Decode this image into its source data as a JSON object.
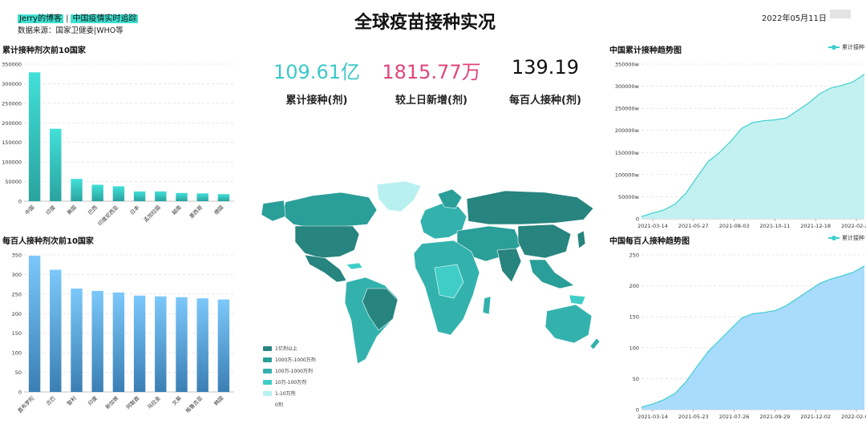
{
  "header": {
    "blog_link": "Jerry的博客",
    "separator": "|",
    "tracker_link": "中国疫情实时追踪",
    "source": "数据来源：国家卫健委|WHO等",
    "title": "全球疫苗接种实况",
    "date": "2022年05月11日"
  },
  "kpis": [
    {
      "value": "109.61亿",
      "label": "累计接种(剂)",
      "color": "#3cc8c8"
    },
    {
      "value": "1815.77万",
      "label": "较上日新增(剂)",
      "color": "#e0457b"
    },
    {
      "value": "139.19",
      "label": "每百人接种(剂)",
      "color": "#111111"
    }
  ],
  "map_legend": [
    {
      "label": "1亿剂以上",
      "color": "#27847f"
    },
    {
      "label": "1000万-1000万剂",
      "color": "#2a9e99"
    },
    {
      "label": "100万-1000万剂",
      "color": "#33b2ad"
    },
    {
      "label": "10万-100万剂",
      "color": "#40cdc7"
    },
    {
      "label": "1-10万剂",
      "color": "#b8f0f0"
    },
    {
      "label": "0剂",
      "color": "#ffffff"
    }
  ],
  "chart_data": [
    {
      "type": "bar",
      "title": "累计接种剂次前10国家",
      "categories": [
        "中国",
        "印度",
        "美国",
        "巴西",
        "印度尼西亚",
        "日本",
        "孟加拉国",
        "越南",
        "墨西哥",
        "德国"
      ],
      "values": [
        329000,
        185000,
        57000,
        42000,
        38000,
        25000,
        25000,
        21000,
        20000,
        18000
      ],
      "ylim": [
        0,
        350000
      ],
      "yticks": [
        "0",
        "50000",
        "100000",
        "150000",
        "200000",
        "250000",
        "300000",
        "350000"
      ],
      "grid": true,
      "color_top": "#41e0d8",
      "color_bottom": "#2aa39f"
    },
    {
      "type": "bar",
      "title": "每百人接种剂次前10国家",
      "categories": [
        "直布罗陀",
        "古巴",
        "智利",
        "印度",
        "新加坡",
        "阿联酋",
        "乌拉圭",
        "文莱",
        "格鲁吉亚",
        "韩国"
      ],
      "values": [
        348,
        312,
        264,
        258,
        254,
        246,
        244,
        242,
        239,
        236
      ],
      "ylim": [
        0,
        350
      ],
      "yticks": [
        "0",
        "50",
        "100",
        "150",
        "200",
        "250",
        "300",
        "350"
      ],
      "grid": true,
      "color_top": "#7cc8fa",
      "color_bottom": "#3a7fb4"
    },
    {
      "type": "area",
      "title": "中国累计接种趋势图",
      "series": [
        {
          "name": "累计接种"
        }
      ],
      "x_ticks": [
        "2021-03-14",
        "2021-05-27",
        "2021-08-03",
        "2021-10-11",
        "2021-12-18",
        "2022-02-26"
      ],
      "x": [
        0,
        0.05,
        0.1,
        0.15,
        0.2,
        0.25,
        0.3,
        0.35,
        0.4,
        0.45,
        0.5,
        0.55,
        0.6,
        0.65,
        0.7,
        0.75,
        0.8,
        0.85,
        0.9,
        0.95,
        1.0
      ],
      "values": [
        5000,
        13000,
        20000,
        33000,
        58000,
        95000,
        130000,
        150000,
        175000,
        205000,
        218000,
        222000,
        224000,
        228000,
        245000,
        262000,
        283000,
        296000,
        302000,
        310000,
        327000
      ],
      "ylim": [
        0,
        350000
      ],
      "yticks": [
        "0",
        "50000w",
        "100000w",
        "150000w",
        "200000w",
        "250000w",
        "300000w",
        "350000w"
      ],
      "grid": true,
      "color_fill": "#c3f1f1",
      "color_line": "#3ecfcf"
    },
    {
      "type": "area",
      "title": "中国每百人接种趋势图",
      "series": [
        {
          "name": "累计接种"
        }
      ],
      "x_ticks": [
        "2021-03-14",
        "2021-05-23",
        "2021-07-26",
        "2021-09-29",
        "2021-12-02",
        "2022-02-05"
      ],
      "x": [
        0,
        0.05,
        0.1,
        0.15,
        0.2,
        0.25,
        0.3,
        0.35,
        0.4,
        0.45,
        0.5,
        0.55,
        0.6,
        0.65,
        0.7,
        0.75,
        0.8,
        0.85,
        0.9,
        0.95,
        1.0
      ],
      "values": [
        4,
        9,
        16,
        26,
        45,
        70,
        94,
        112,
        130,
        148,
        155,
        157,
        160,
        168,
        180,
        192,
        204,
        211,
        216,
        222,
        232
      ],
      "ylim": [
        0,
        250
      ],
      "yticks": [
        "0",
        "50",
        "100",
        "150",
        "200",
        "250"
      ],
      "grid": true,
      "color_fill": "#a9dbfc",
      "color_line": "#3ecfcf"
    }
  ]
}
